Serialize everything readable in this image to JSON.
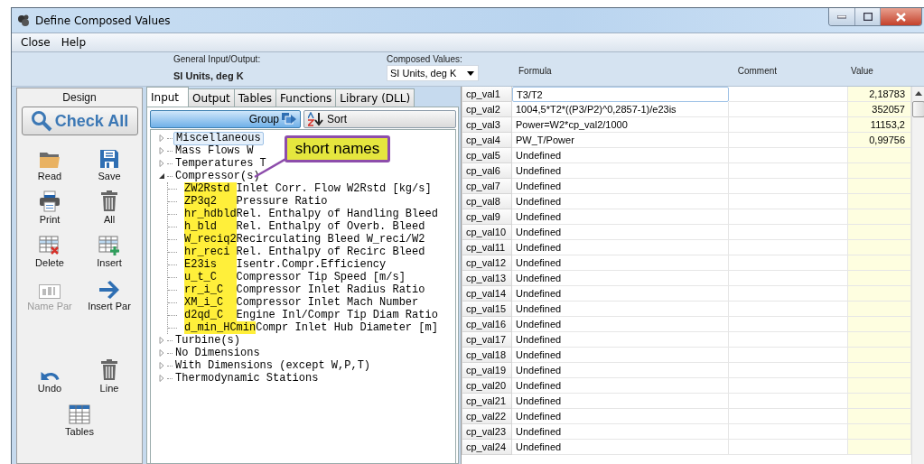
{
  "window": {
    "title": "Define Composed Values"
  },
  "menu": [
    "Close",
    "Help"
  ],
  "header": {
    "general_label": "General Input/Output:",
    "general_value": "SI Units, deg K",
    "composed_label": "Composed Values:",
    "composed_value": "SI Units, deg K",
    "columns": [
      "Formula",
      "Comment",
      "Value"
    ]
  },
  "design": {
    "title": "Design",
    "check_all": "Check All",
    "tools": [
      {
        "label": "Read",
        "disabled": false
      },
      {
        "label": "Save",
        "disabled": false
      },
      {
        "label": "Print",
        "disabled": false
      },
      {
        "label": "All",
        "disabled": false
      },
      {
        "label": "Delete",
        "disabled": false
      },
      {
        "label": "Insert",
        "disabled": false
      },
      {
        "label": "Name Par",
        "disabled": true
      },
      {
        "label": "Insert Par",
        "disabled": false
      }
    ],
    "bottom_tools": [
      {
        "label": "Undo",
        "disabled": false
      },
      {
        "label": "Line",
        "disabled": false
      },
      {
        "label": "Tables",
        "disabled": false
      }
    ]
  },
  "tabs": [
    {
      "label": "Input",
      "selected": true
    },
    {
      "label": "Output",
      "selected": false
    },
    {
      "label": "Tables",
      "selected": false
    },
    {
      "label": "Functions",
      "selected": false
    },
    {
      "label": "Library (DLL)",
      "selected": false
    }
  ],
  "view_buttons": [
    {
      "label": "Group",
      "selected": true
    },
    {
      "label": "Sort",
      "selected": false
    }
  ],
  "tree": [
    {
      "label": "Miscellaneous",
      "expanded": false,
      "selected": true
    },
    {
      "label": "Mass Flows W",
      "expanded": false,
      "selected": false
    },
    {
      "label": "Temperatures T",
      "expanded": false,
      "selected": false
    },
    {
      "label": "Compressor(s)",
      "expanded": true,
      "selected": false,
      "children": [
        {
          "name": "ZW2Rstd",
          "description": "Inlet Corr. Flow W2Rstd [kg/s]",
          "highlighted": true
        },
        {
          "name": "ZP3q2",
          "description": "Pressure Ratio",
          "highlighted": true
        },
        {
          "name": "hr_hdbld",
          "description": "Rel. Enthalpy of Handling Bleed",
          "highlighted": true
        },
        {
          "name": "h_bld",
          "description": "Rel. Enthalpy of Overb. Bleed",
          "highlighted": true
        },
        {
          "name": "W_reciq2",
          "description": "Recirculating Bleed W_reci/W2",
          "highlighted": true
        },
        {
          "name": "hr_reci",
          "description": "Rel. Enthalpy of Recirc Bleed",
          "highlighted": true
        },
        {
          "name": "E23is",
          "description": "Isentr.Compr.Efficiency",
          "highlighted": true
        },
        {
          "name": "u_t_C",
          "description": "Compressor Tip Speed [m/s]",
          "highlighted": true
        },
        {
          "name": "rr_i_C",
          "description": "Compressor Inlet Radius Ratio",
          "highlighted": true
        },
        {
          "name": "XM_i_C",
          "description": "Compressor Inlet Mach Number",
          "highlighted": true
        },
        {
          "name": "d2qd_C",
          "description": "Engine Inl/Compr Tip Diam Ratio",
          "highlighted": true
        },
        {
          "name": "d_min_HCmin",
          "description": "Compr Inlet Hub Diameter [m]",
          "highlighted": true
        }
      ]
    },
    {
      "label": "Turbine(s)",
      "expanded": false,
      "selected": false
    },
    {
      "label": "No Dimensions",
      "expanded": false,
      "selected": false
    },
    {
      "label": "With Dimensions (except W,P,T)",
      "expanded": false,
      "selected": false
    },
    {
      "label": "Thermodynamic Stations",
      "expanded": false,
      "selected": false
    }
  ],
  "callout": "short names",
  "rows": [
    {
      "name": "cp_val1",
      "formula": "T3/T2",
      "value": "2,18783",
      "selected": true
    },
    {
      "name": "cp_val2",
      "formula": "1004,5*T2*((P3/P2)^0,2857-1)/e23is",
      "value": "352057",
      "selected": false
    },
    {
      "name": "cp_val3",
      "formula": "Power=W2*cp_val2/1000",
      "value": "11153,2",
      "selected": false
    },
    {
      "name": "cp_val4",
      "formula": "PW_T/Power",
      "value": "0,99756",
      "selected": false
    },
    {
      "name": "cp_val5",
      "formula": "Undefined",
      "selected": false
    },
    {
      "name": "cp_val6",
      "formula": "Undefined",
      "selected": false
    },
    {
      "name": "cp_val7",
      "formula": "Undefined",
      "selected": false
    },
    {
      "name": "cp_val8",
      "formula": "Undefined",
      "selected": false
    },
    {
      "name": "cp_val9",
      "formula": "Undefined",
      "selected": false
    },
    {
      "name": "cp_val10",
      "formula": "Undefined",
      "selected": false
    },
    {
      "name": "cp_val11",
      "formula": "Undefined",
      "selected": false
    },
    {
      "name": "cp_val12",
      "formula": "Undefined",
      "selected": false
    },
    {
      "name": "cp_val13",
      "formula": "Undefined",
      "selected": false
    },
    {
      "name": "cp_val14",
      "formula": "Undefined",
      "selected": false
    },
    {
      "name": "cp_val15",
      "formula": "Undefined",
      "selected": false
    },
    {
      "name": "cp_val16",
      "formula": "Undefined",
      "selected": false
    },
    {
      "name": "cp_val17",
      "formula": "Undefined",
      "selected": false
    },
    {
      "name": "cp_val18",
      "formula": "Undefined",
      "selected": false
    },
    {
      "name": "cp_val19",
      "formula": "Undefined",
      "selected": false
    },
    {
      "name": "cp_val20",
      "formula": "Undefined",
      "selected": false
    },
    {
      "name": "cp_val21",
      "formula": "Undefined",
      "selected": false
    },
    {
      "name": "cp_val22",
      "formula": "Undefined",
      "selected": false
    },
    {
      "name": "cp_val23",
      "formula": "Undefined",
      "selected": false
    },
    {
      "name": "cp_val24",
      "formula": "Undefined",
      "selected": false
    }
  ]
}
